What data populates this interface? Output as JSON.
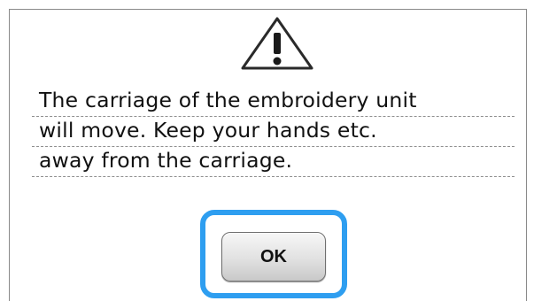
{
  "dialog": {
    "icon": "warning-icon",
    "message_lines": [
      "The carriage of the embroidery unit",
      "will move. Keep your hands etc.",
      "away from the carriage."
    ],
    "ok_label": "OK"
  },
  "colors": {
    "highlight": "#2e9ef0",
    "button_face": "#e1e1e1",
    "border": "#8a8a8a"
  }
}
